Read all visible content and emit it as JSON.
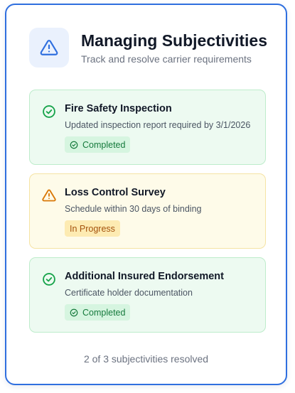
{
  "header": {
    "icon": "warning-triangle-icon",
    "title": "Managing Subjectivities",
    "subtitle": "Track and resolve carrier requirements"
  },
  "colors": {
    "accent": "#2f6fdf",
    "completed": "#16a34a",
    "in_progress": "#d97706"
  },
  "subjectivities": [
    {
      "icon": "check-circle-icon",
      "title": "Fire Safety Inspection",
      "description": "Updated inspection report required by 3/1/2026",
      "status": "Completed"
    },
    {
      "icon": "warning-triangle-icon",
      "title": "Loss Control Survey",
      "description": "Schedule within 30 days of binding",
      "status": "In Progress"
    },
    {
      "icon": "check-circle-icon",
      "title": "Additional Insured Endorsement",
      "description": "Certificate holder documentation",
      "status": "Completed"
    }
  ],
  "footer": {
    "summary": "2 of 3 subjectivities resolved"
  }
}
